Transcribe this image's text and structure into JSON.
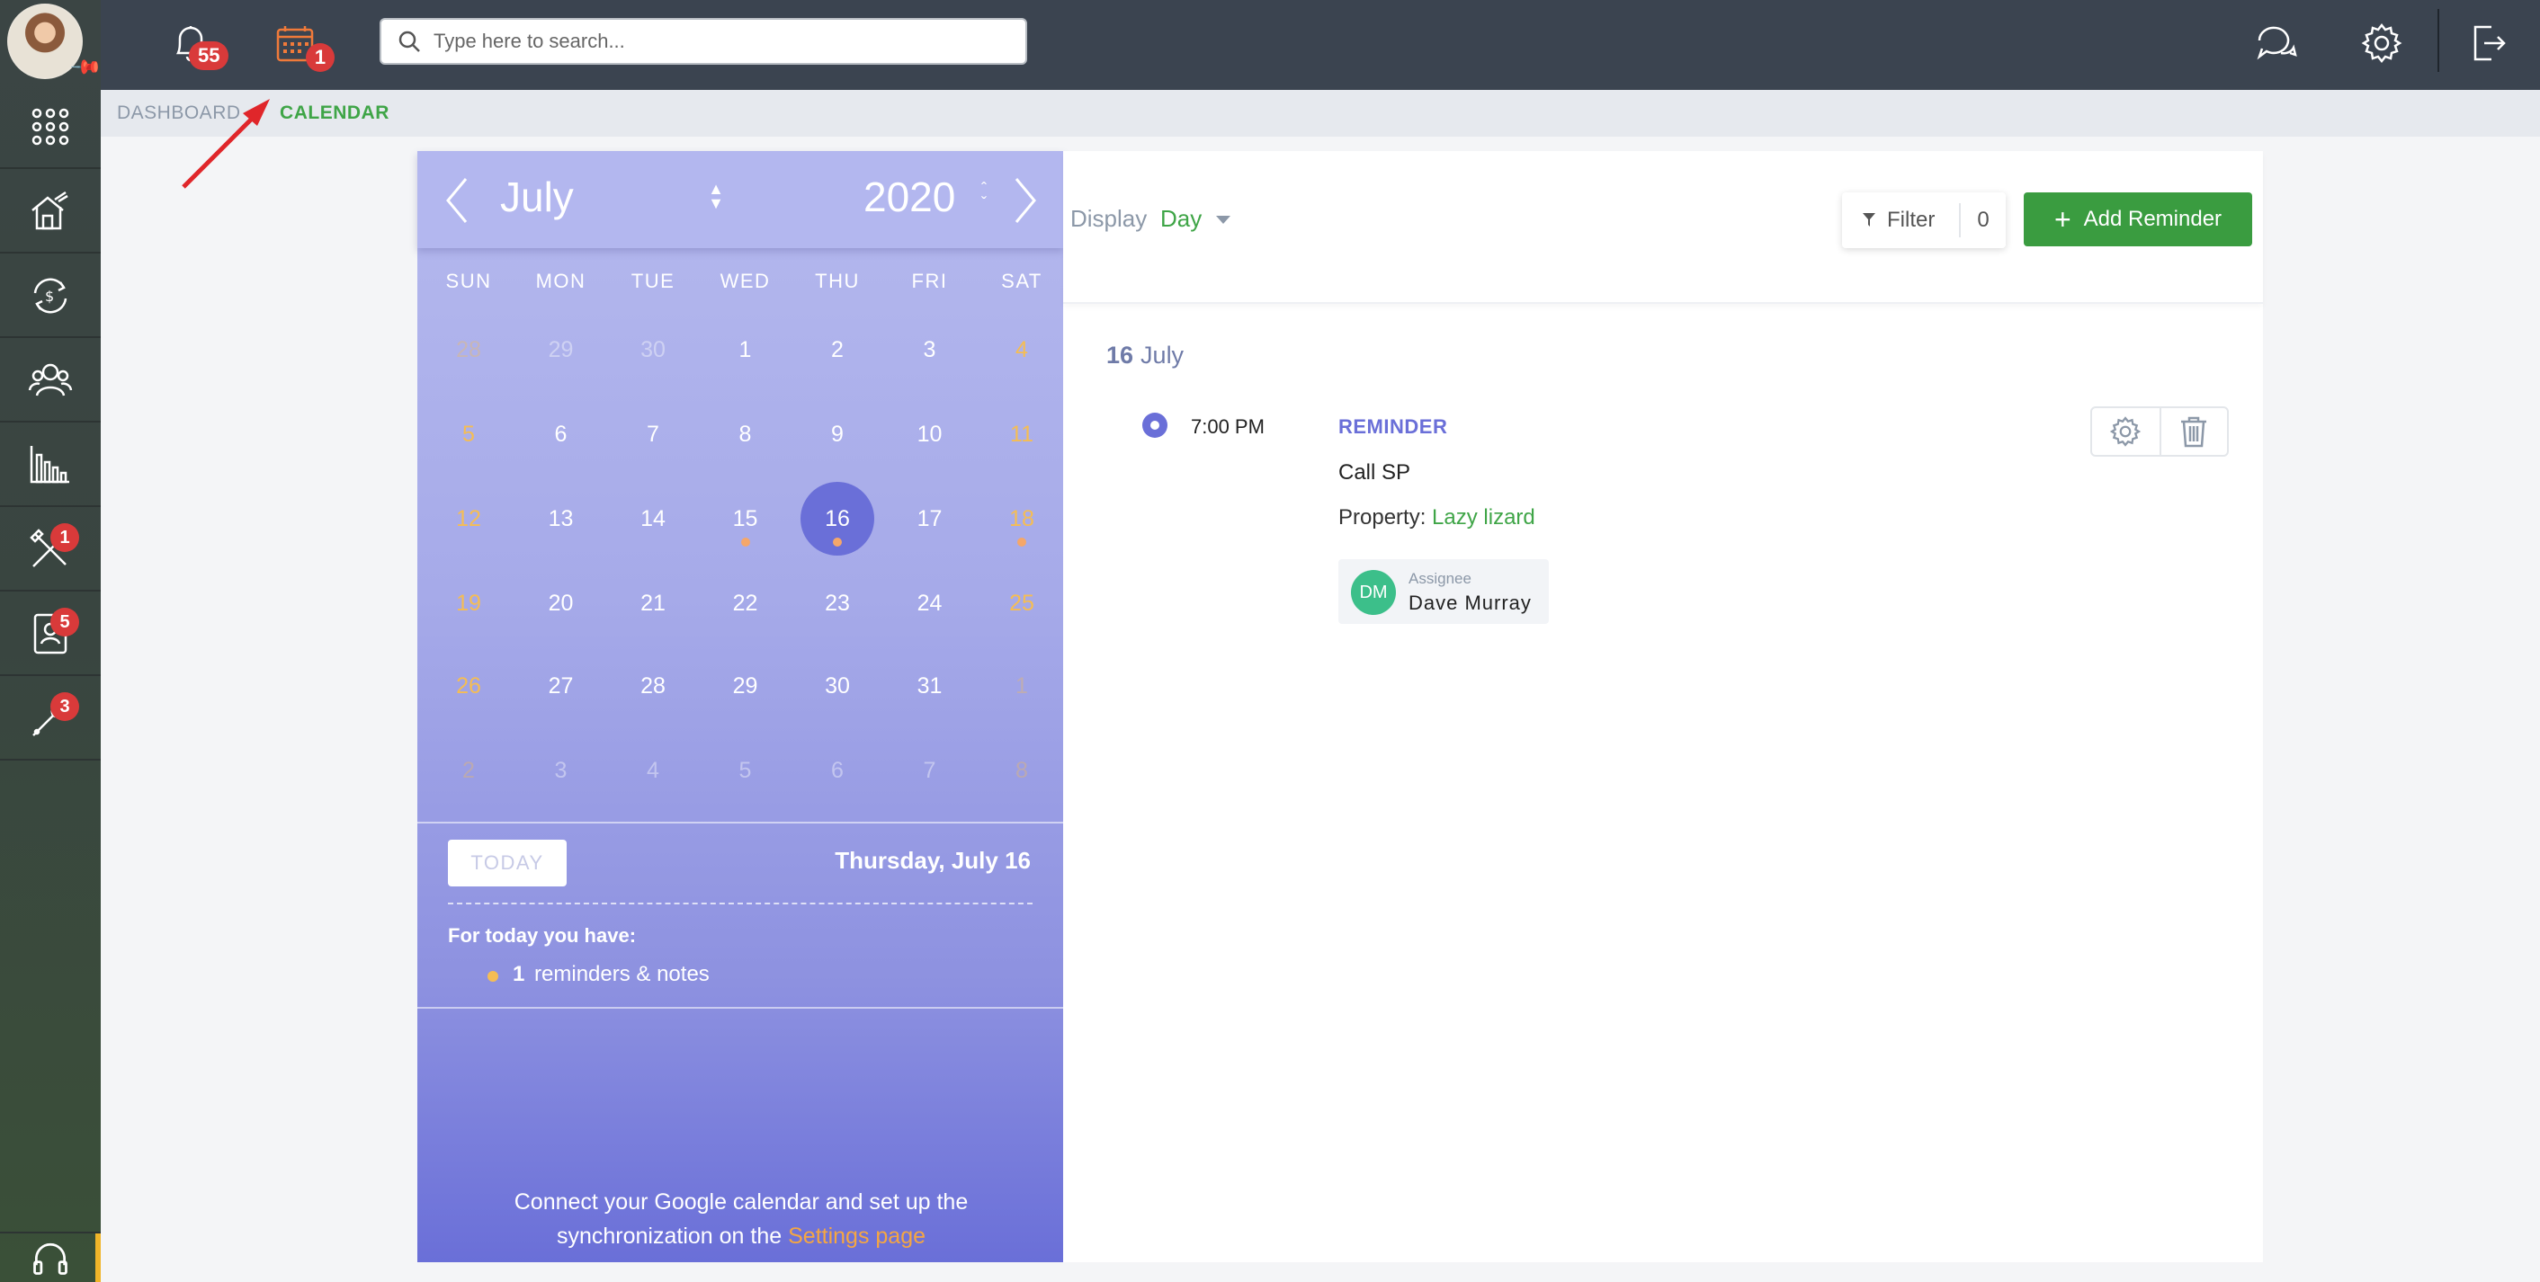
{
  "topbar": {
    "notifications_count": "55",
    "calendar_count": "1",
    "search_placeholder": "Type here to search..."
  },
  "sidebar": {
    "items": [
      {
        "name": "apps",
        "icon": "grid-icon",
        "badge": ""
      },
      {
        "name": "properties",
        "icon": "house-icon",
        "badge": ""
      },
      {
        "name": "finance",
        "icon": "money-cycle-icon",
        "badge": ""
      },
      {
        "name": "contacts",
        "icon": "people-icon",
        "badge": ""
      },
      {
        "name": "reports",
        "icon": "bar-chart-icon",
        "badge": ""
      },
      {
        "name": "maintenance",
        "icon": "tools-icon",
        "badge": "1"
      },
      {
        "name": "tenants",
        "icon": "contact-card-icon",
        "badge": "5"
      },
      {
        "name": "vendors",
        "icon": "wrench-icon",
        "badge": "3"
      }
    ]
  },
  "breadcrumb": {
    "parent": "DASHBOARD",
    "current": "CALENDAR"
  },
  "calendar": {
    "month": "July",
    "year": "2020",
    "weekdays": [
      "SUN",
      "MON",
      "TUE",
      "WED",
      "THU",
      "FRI",
      "SAT"
    ],
    "weeks": [
      [
        "28",
        "29",
        "30",
        "1",
        "2",
        "3",
        "4"
      ],
      [
        "5",
        "6",
        "7",
        "8",
        "9",
        "10",
        "11"
      ],
      [
        "12",
        "13",
        "14",
        "15",
        "16",
        "17",
        "18"
      ],
      [
        "19",
        "20",
        "21",
        "22",
        "23",
        "24",
        "25"
      ],
      [
        "26",
        "27",
        "28",
        "29",
        "30",
        "31",
        "1"
      ],
      [
        "2",
        "3",
        "4",
        "5",
        "6",
        "7",
        "8"
      ]
    ],
    "selected_day": "16",
    "days_with_events": [
      "15",
      "16",
      "18"
    ],
    "today_button": "TODAY",
    "today_date": "Thursday, July 16",
    "today_note": "For today you have:",
    "today_count": "1",
    "today_item_text": "reminders & notes",
    "gcal_text_1": "Connect your Google calendar and set up the",
    "gcal_text_2": "synchronization on the",
    "gcal_link": "Settings page"
  },
  "toolbar": {
    "display_label": "Display",
    "display_value": "Day",
    "filter_label": "Filter",
    "filter_count": "0",
    "add_button": "Add Reminder"
  },
  "agenda": {
    "day_num": "16",
    "day_month": "July",
    "reminder": {
      "time": "7:00 PM",
      "type": "REMINDER",
      "title": "Call SP",
      "property_label": "Property:",
      "property_value": "Lazy lizard",
      "assignee_label": "Assignee",
      "assignee_initials": "DM",
      "assignee_name": "Dave Murray"
    }
  },
  "colors": {
    "accent_green": "#3fa547",
    "calendar_purple": "#6a6fd8",
    "badge_red": "#d93a3a",
    "weekend_orange": "#f5bd54"
  }
}
